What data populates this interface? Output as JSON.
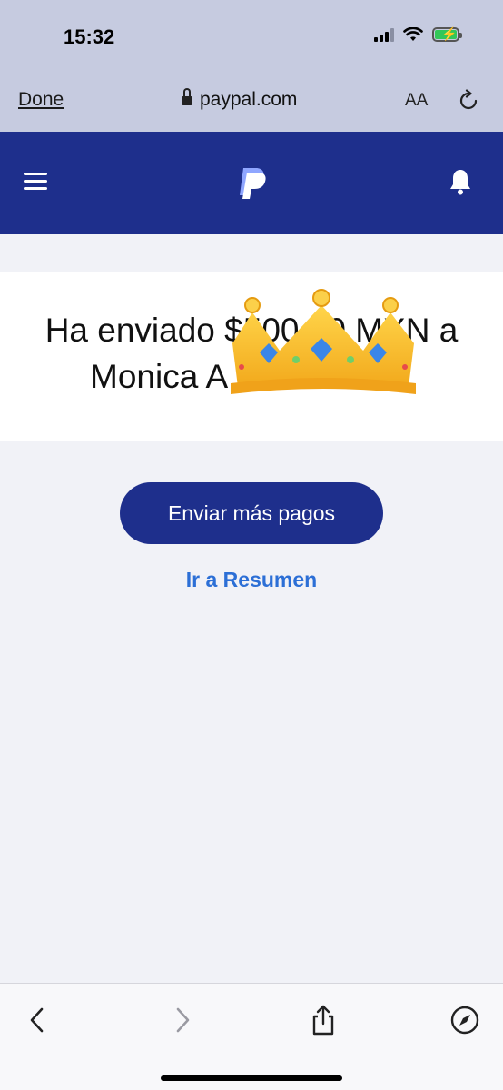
{
  "status_bar": {
    "time": "15:32"
  },
  "browser": {
    "done_label": "Done",
    "url": "paypal.com",
    "text_size_label": "AA"
  },
  "colors": {
    "paypal_navy": "#1e2f8c",
    "link_blue": "#2c6fd6",
    "chrome_bg": "#c6cbe0"
  },
  "nav": {
    "menu_icon": "hamburger-icon",
    "logo_letter": "P",
    "bell_icon": "bell-icon"
  },
  "content": {
    "message_line1": "Ha enviado $500.00 MXN a",
    "message_line2": "Monica A",
    "send_more_label": "Enviar más pagos",
    "summary_link_label": "Ir a Resumen"
  },
  "toolbar": {
    "icons": [
      "back-chevron-icon",
      "forward-chevron-icon",
      "share-icon",
      "compass-icon"
    ]
  }
}
